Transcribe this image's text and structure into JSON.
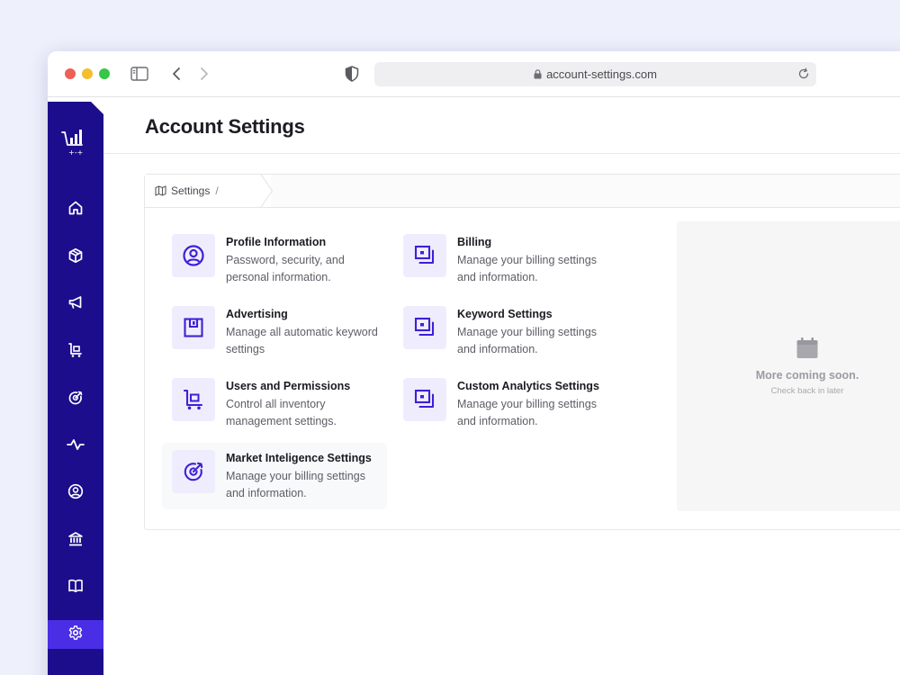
{
  "browser": {
    "url": "account-settings.com"
  },
  "header": {
    "title": "Account Settings"
  },
  "breadcrumb": {
    "items": [
      "Settings"
    ],
    "separator": "/"
  },
  "cards": [
    {
      "title": "Profile Information",
      "description": "Password, security, and personal information.",
      "icon": "user-circle-icon"
    },
    {
      "title": "Billing",
      "description": "Manage your billing settings and information.",
      "icon": "billing-icon"
    },
    {
      "title": "Advertising",
      "description": "Manage all automatic keyword settings",
      "icon": "advertising-icon"
    },
    {
      "title": "Keyword Settings",
      "description": "Manage your billing settings and information.",
      "icon": "billing-icon"
    },
    {
      "title": "Users and Permissions",
      "description": "Control all inventory management settings.",
      "icon": "inventory-cart-icon"
    },
    {
      "title": "Custom Analytics Settings",
      "description": "Manage your billing settings and information.",
      "icon": "billing-icon"
    },
    {
      "title": "Market Inteligence Settings",
      "description": "Manage your billing settings and information.",
      "icon": "target-icon"
    }
  ],
  "coming_soon": {
    "title": "More coming soon.",
    "subtitle": "Check back in later",
    "icon": "calendar-icon"
  },
  "sidebar": {
    "items": [
      {
        "icon": "home-icon"
      },
      {
        "icon": "box-icon"
      },
      {
        "icon": "megaphone-icon"
      },
      {
        "icon": "inventory-cart-icon"
      },
      {
        "icon": "target-icon"
      },
      {
        "icon": "activity-icon"
      },
      {
        "icon": "user-circle-icon"
      },
      {
        "icon": "bank-icon"
      },
      {
        "icon": "book-icon"
      },
      {
        "icon": "gear-icon",
        "active": true
      }
    ]
  },
  "colors": {
    "sidebar_bg": "#1c0d8c",
    "sidebar_active": "#4a2ee6",
    "icon_accent": "#3f1fd6",
    "icon_tile_bg": "#efedfd"
  }
}
